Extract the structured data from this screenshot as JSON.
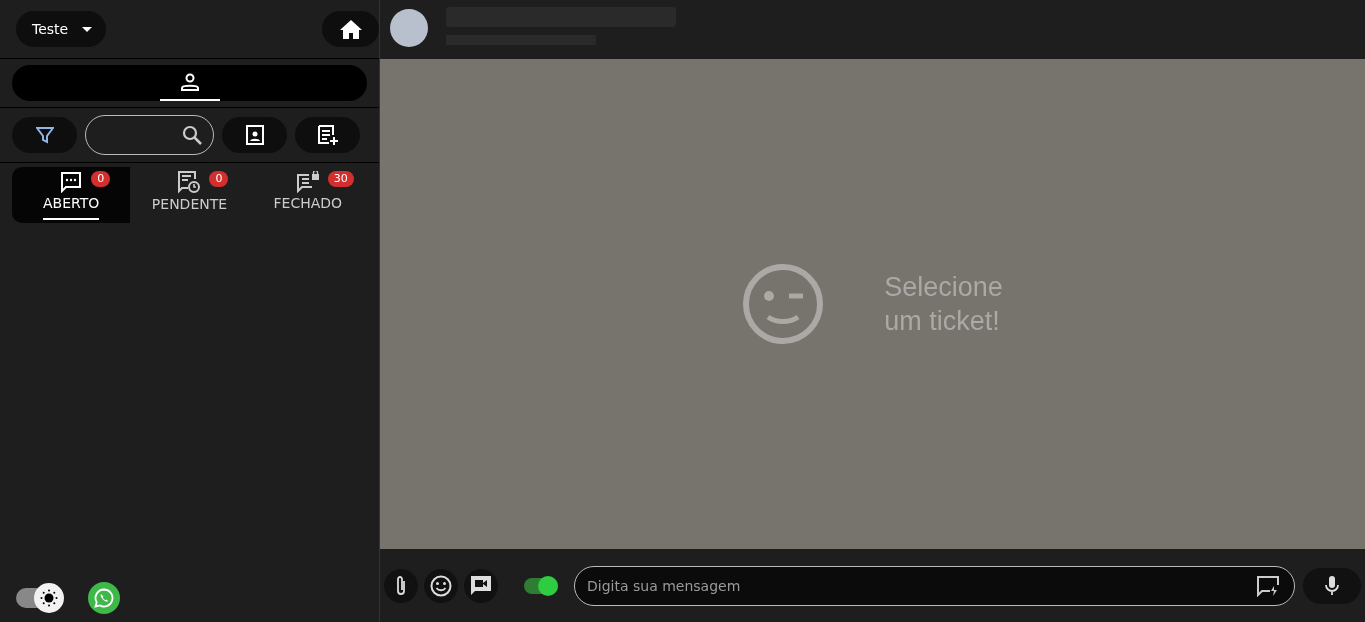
{
  "user_menu": {
    "label": "Teste"
  },
  "account_tabs": [
    {
      "selected": true
    }
  ],
  "status_tabs": [
    {
      "kind": "open",
      "label": "ABERTO",
      "count": "0",
      "selected": true
    },
    {
      "kind": "pending",
      "label": "PENDENTE",
      "count": "0",
      "selected": false
    },
    {
      "kind": "closed",
      "label": "FECHADO",
      "count": "30",
      "selected": false
    }
  ],
  "theme_toggle": {
    "on": true
  },
  "empty_state": {
    "lines": [
      "Selecione",
      "um ticket!"
    ]
  },
  "composer": {
    "signature_on": true,
    "placeholder": "Digita sua mensagem"
  }
}
